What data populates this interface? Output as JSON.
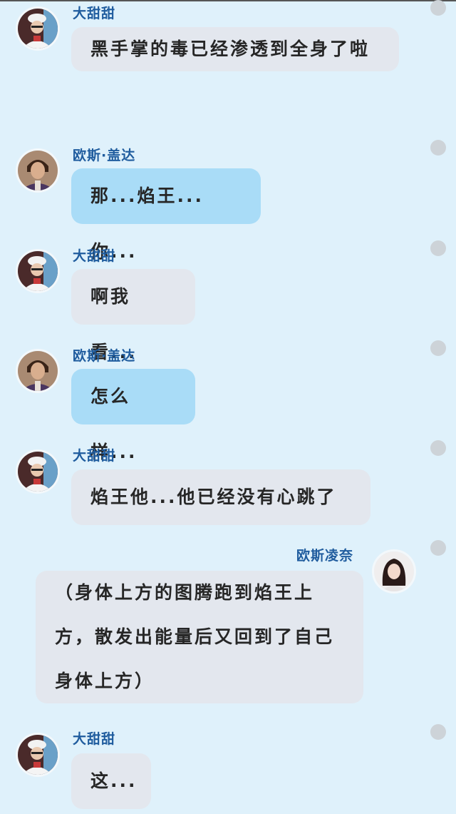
{
  "messages": [
    {
      "sender": "大甜甜",
      "text": "黑手掌的毒已经渗透到全身了啦"
    },
    {
      "sender": "欧斯·盖达",
      "text": "那...焰王...你..."
    },
    {
      "sender": "大甜甜",
      "text": "啊我看..."
    },
    {
      "sender": "欧斯·盖达",
      "text": "怎么样..."
    },
    {
      "sender": "大甜甜",
      "text": "焰王他...他已经没有心跳了"
    },
    {
      "sender": "欧斯凌奈",
      "text": "（身体上方的图腾跑到焰王上方，散发出能量后又回到了自己身体上方）"
    },
    {
      "sender": "大甜甜",
      "text": "这..."
    }
  ],
  "colors": {
    "background": "#dff1fb",
    "bubble_grey": "#e3e7ee",
    "bubble_blue": "#a9dcf7",
    "name_text": "#1f5c9e"
  }
}
